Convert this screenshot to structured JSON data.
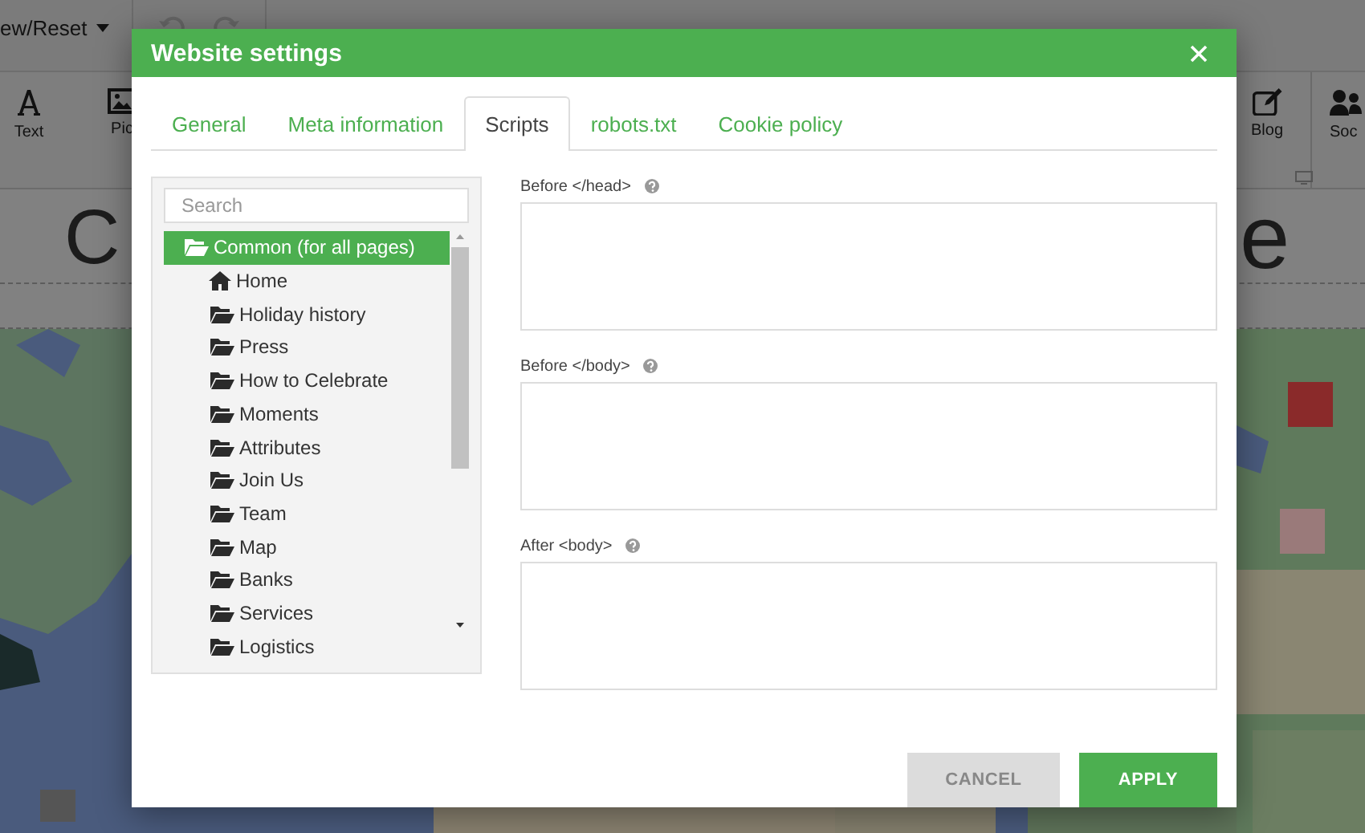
{
  "editor": {
    "menu_label": "ew/Reset",
    "toolbar": [
      {
        "label": "Text",
        "kind": "text"
      },
      {
        "label": "Pic",
        "kind": "picture"
      },
      {
        "label": "Blog",
        "kind": "blog"
      },
      {
        "label": "Soc",
        "kind": "social"
      }
    ],
    "heading_left": "C",
    "heading_right": "e"
  },
  "dialog": {
    "title": "Website settings",
    "tabs": [
      {
        "label": "General",
        "selected": false
      },
      {
        "label": "Meta information",
        "selected": false
      },
      {
        "label": "Scripts",
        "selected": true
      },
      {
        "label": "robots.txt",
        "selected": false
      },
      {
        "label": "Cookie policy",
        "selected": false
      }
    ],
    "search": {
      "placeholder": "Search"
    },
    "tree": [
      {
        "label": "Common (for all pages)",
        "kind": "folder",
        "selected": true,
        "children": [
          {
            "label": "Home",
            "kind": "home",
            "selected": false
          },
          {
            "label": "Holiday history",
            "kind": "folder",
            "selected": false
          },
          {
            "label": "Press",
            "kind": "folder",
            "selected": false
          },
          {
            "label": "How to Celebrate",
            "kind": "folder",
            "selected": false
          },
          {
            "label": "Moments",
            "kind": "folder",
            "selected": false
          },
          {
            "label": "Attributes",
            "kind": "folder",
            "selected": false
          },
          {
            "label": "Join Us",
            "kind": "folder",
            "selected": false
          },
          {
            "label": "Team",
            "kind": "folder",
            "selected": false
          },
          {
            "label": "Map",
            "kind": "folder",
            "selected": false
          },
          {
            "label": "Banks",
            "kind": "folder",
            "selected": false
          },
          {
            "label": "Services",
            "kind": "folder",
            "selected": false
          },
          {
            "label": "Logistics",
            "kind": "folder",
            "selected": false
          }
        ]
      }
    ],
    "fields": [
      {
        "label": "Before </head>"
      },
      {
        "label": "Before </body>"
      },
      {
        "label": "After <body>"
      }
    ],
    "buttons": [
      {
        "label": "CANCEL",
        "kind": "secondary"
      },
      {
        "label": "APPLY",
        "kind": "primary"
      }
    ]
  }
}
